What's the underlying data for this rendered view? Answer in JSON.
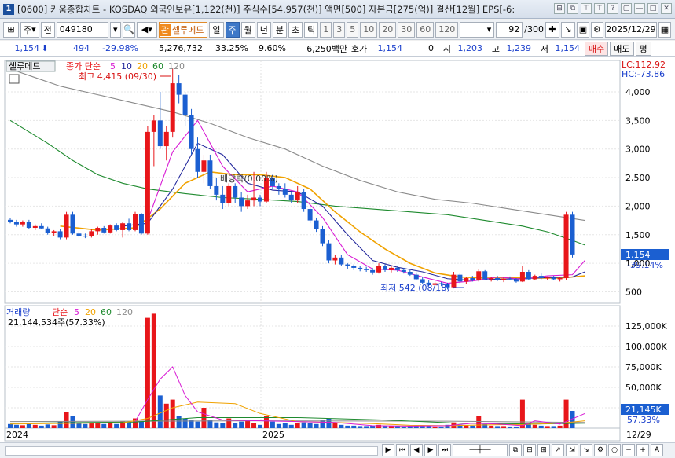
{
  "window": {
    "badge": "1",
    "title": "[0600] 키움종합차트 - KOSDAQ 외국인보유[1,122(천)] 주식수[54,957(천)] 액면[500] 자본금[275(억)] 결산[12월] EPS[-6:",
    "buttons": [
      "⊟",
      "⧉",
      "⊤",
      "T",
      "?",
      "▢",
      "—",
      "□",
      "✕"
    ]
  },
  "toolbar": {
    "period_type": "주",
    "prev": "전",
    "code": "049180",
    "stock_name": "셀루메드",
    "stock_badge": "관",
    "periods": [
      "일",
      "주",
      "월",
      "년",
      "분",
      "초",
      "틱"
    ],
    "selected_period": "주",
    "minutes": [
      "1",
      "3",
      "5",
      "10",
      "20",
      "30",
      "60",
      "120"
    ],
    "count": "92",
    "count_total": "/300",
    "date": "2025/12/29"
  },
  "quote": {
    "price": "1,154",
    "change": "494",
    "change_pct": "-29.98%",
    "volume": "5,276,732",
    "turnover": "33.25%",
    "extra_pct": "9.60%",
    "amount": "6,250백만",
    "hoga_label": "호가",
    "hoga": "1,154",
    "hoga_qty": "0",
    "open_label": "시",
    "open": "1,203",
    "high_label": "고",
    "high": "1,239",
    "low_label": "저",
    "low": "1,154",
    "buy_label": "매수",
    "sell_label": "매도",
    "eval_label": "평"
  },
  "colors": {
    "up": "#e8161a",
    "down": "#1b5fd1",
    "ma5": "#d81bd4",
    "ma10": "#23289c",
    "ma20": "#f0a200",
    "ma60": "#1e8a2e",
    "ma120": "#8a8a8a"
  },
  "price_panel": {
    "name_tag": "셀루메드",
    "legend_prefix": "종가 단순",
    "legend": [
      "5",
      "10",
      "20",
      "60",
      "120"
    ],
    "lc": "LC:112.92",
    "hc": "HC:-73.86",
    "high_note": "최고 4,415 (09/30)",
    "low_note": "최저 542 (08/18)",
    "event_note": "배당락(0.00%)",
    "current_price": "1,154",
    "current_pct": "-39.14%",
    "y_ticks": [
      "4,000",
      "3,500",
      "3,000",
      "2,500",
      "2,000",
      "1,500",
      "1,000",
      "500"
    ]
  },
  "volume_panel": {
    "name": "거래량",
    "legend_prefix": "단순",
    "legend": [
      "5",
      "20",
      "60",
      "120"
    ],
    "summary": "21,144,534주(57.33%)",
    "current": "21,145K",
    "current_pct": "57.33%",
    "y_ticks": [
      "125,000K",
      "100,000K",
      "75,000K",
      "50,000K",
      "25,000K"
    ]
  },
  "x_labels": [
    "2024",
    "2025"
  ],
  "x_end_label": "12/29",
  "chart_data": {
    "type": "candlestick",
    "period": "weekly",
    "price_ylim": [
      300,
      4550
    ],
    "volume_ylim": [
      0,
      150000
    ],
    "volume_unit": "K",
    "candles": [
      [
        1760,
        1800,
        1700,
        1730,
        5000
      ],
      [
        1730,
        1760,
        1640,
        1680,
        4000
      ],
      [
        1680,
        1750,
        1640,
        1720,
        3500
      ],
      [
        1720,
        1760,
        1600,
        1620,
        6000
      ],
      [
        1620,
        1680,
        1580,
        1650,
        4000
      ],
      [
        1650,
        1700,
        1600,
        1610,
        3000
      ],
      [
        1610,
        1640,
        1500,
        1530,
        4500
      ],
      [
        1530,
        1580,
        1480,
        1560,
        3500
      ],
      [
        1560,
        1600,
        1420,
        1450,
        8000
      ],
      [
        1450,
        1900,
        1420,
        1850,
        20000
      ],
      [
        1850,
        1900,
        1500,
        1520,
        15000
      ],
      [
        1520,
        1560,
        1450,
        1480,
        7000
      ],
      [
        1480,
        1520,
        1440,
        1470,
        5000
      ],
      [
        1470,
        1600,
        1450,
        1560,
        6000
      ],
      [
        1560,
        1640,
        1500,
        1620,
        7000
      ],
      [
        1620,
        1650,
        1520,
        1540,
        5000
      ],
      [
        1540,
        1680,
        1520,
        1660,
        6000
      ],
      [
        1660,
        1700,
        1560,
        1580,
        5000
      ],
      [
        1580,
        1720,
        1450,
        1700,
        8000
      ],
      [
        1700,
        1780,
        1560,
        1580,
        7000
      ],
      [
        1580,
        1900,
        1560,
        1860,
        12000
      ],
      [
        1860,
        1880,
        1500,
        1520,
        9000
      ],
      [
        1520,
        3400,
        1500,
        3300,
        135000
      ],
      [
        3300,
        3600,
        2700,
        3500,
        140000
      ],
      [
        3500,
        4000,
        3000,
        3050,
        40000
      ],
      [
        3050,
        3400,
        2800,
        3300,
        30000
      ],
      [
        3300,
        4415,
        3200,
        4150,
        35000
      ],
      [
        4150,
        4300,
        3800,
        3950,
        15000
      ],
      [
        3950,
        4000,
        3400,
        3600,
        12000
      ],
      [
        3600,
        3700,
        2900,
        3000,
        10000
      ],
      [
        3000,
        3200,
        2500,
        2600,
        8000
      ],
      [
        2600,
        2900,
        2400,
        2800,
        25000
      ],
      [
        2800,
        2900,
        2300,
        2350,
        10000
      ],
      [
        2350,
        2500,
        2100,
        2200,
        7000
      ],
      [
        2200,
        2350,
        1950,
        2050,
        6000
      ],
      [
        2050,
        2400,
        2000,
        2350,
        12000
      ],
      [
        2350,
        2400,
        2050,
        2150,
        6000
      ],
      [
        2150,
        2250,
        1900,
        2000,
        8000
      ],
      [
        2000,
        2200,
        1950,
        2100,
        9000
      ],
      [
        2100,
        2600,
        2000,
        2150,
        6000
      ],
      [
        2150,
        2200,
        2000,
        2080,
        4000
      ],
      [
        2080,
        2600,
        2050,
        2500,
        15000
      ],
      [
        2500,
        2550,
        2300,
        2350,
        8000
      ],
      [
        2350,
        2400,
        2200,
        2300,
        5000
      ],
      [
        2300,
        2400,
        2150,
        2200,
        6000
      ],
      [
        2200,
        2250,
        2050,
        2100,
        4000
      ],
      [
        2100,
        2350,
        2050,
        2250,
        6000
      ],
      [
        2250,
        2300,
        1900,
        1950,
        7000
      ],
      [
        1950,
        2000,
        1700,
        1750,
        6000
      ],
      [
        1750,
        1800,
        1550,
        1600,
        5000
      ],
      [
        1600,
        1650,
        1300,
        1350,
        10000
      ],
      [
        1350,
        1400,
        1000,
        1050,
        12000
      ],
      [
        1050,
        1150,
        980,
        1100,
        7000
      ],
      [
        1100,
        1150,
        950,
        980,
        4000
      ],
      [
        980,
        1000,
        900,
        950,
        3000
      ],
      [
        950,
        980,
        880,
        920,
        3000
      ],
      [
        920,
        960,
        860,
        900,
        2500
      ],
      [
        900,
        940,
        850,
        880,
        2500
      ],
      [
        880,
        920,
        800,
        840,
        3000
      ],
      [
        840,
        1000,
        820,
        950,
        4000
      ],
      [
        950,
        980,
        850,
        880,
        3000
      ],
      [
        880,
        960,
        840,
        920,
        2500
      ],
      [
        920,
        950,
        850,
        880,
        2500
      ],
      [
        880,
        920,
        820,
        850,
        2000
      ],
      [
        850,
        880,
        780,
        800,
        2500
      ],
      [
        800,
        840,
        700,
        720,
        3000
      ],
      [
        720,
        760,
        640,
        660,
        3500
      ],
      [
        660,
        700,
        600,
        620,
        2500
      ],
      [
        620,
        680,
        600,
        650,
        2000
      ],
      [
        650,
        670,
        600,
        630,
        2000
      ],
      [
        630,
        660,
        542,
        580,
        4000
      ],
      [
        580,
        850,
        560,
        800,
        7000
      ],
      [
        800,
        820,
        650,
        680,
        4000
      ],
      [
        680,
        760,
        640,
        740,
        3500
      ],
      [
        740,
        780,
        680,
        700,
        3000
      ],
      [
        700,
        900,
        680,
        860,
        15000
      ],
      [
        860,
        880,
        700,
        720,
        5000
      ],
      [
        720,
        760,
        680,
        740,
        3000
      ],
      [
        740,
        780,
        690,
        700,
        2500
      ],
      [
        700,
        750,
        670,
        730,
        2500
      ],
      [
        730,
        770,
        700,
        720,
        2000
      ],
      [
        720,
        740,
        660,
        680,
        2000
      ],
      [
        680,
        950,
        670,
        850,
        35000
      ],
      [
        850,
        880,
        700,
        720,
        6000
      ],
      [
        720,
        800,
        700,
        780,
        4000
      ],
      [
        780,
        820,
        720,
        740,
        3000
      ],
      [
        740,
        770,
        700,
        750,
        2500
      ],
      [
        750,
        780,
        700,
        720,
        2500
      ],
      [
        720,
        760,
        680,
        740,
        3000
      ],
      [
        740,
        1900,
        700,
        1850,
        35000
      ],
      [
        1850,
        1900,
        1100,
        1154,
        21145
      ]
    ],
    "ma": {
      "ma5": [
        [
          22,
          1750
        ],
        [
          26,
          2950
        ],
        [
          30,
          3500
        ],
        [
          34,
          2700
        ],
        [
          38,
          2250
        ],
        [
          42,
          2350
        ],
        [
          46,
          2250
        ],
        [
          50,
          1800
        ],
        [
          54,
          1150
        ],
        [
          58,
          900
        ],
        [
          62,
          880
        ],
        [
          66,
          760
        ],
        [
          70,
          650
        ],
        [
          74,
          690
        ],
        [
          78,
          760
        ],
        [
          82,
          720
        ],
        [
          86,
          780
        ],
        [
          90,
          800
        ],
        [
          92,
          1050
        ]
      ],
      "ma10": [
        [
          18,
          1650
        ],
        [
          22,
          1700
        ],
        [
          26,
          2300
        ],
        [
          30,
          3100
        ],
        [
          34,
          2900
        ],
        [
          38,
          2400
        ],
        [
          42,
          2280
        ],
        [
          46,
          2250
        ],
        [
          50,
          2000
        ],
        [
          54,
          1500
        ],
        [
          58,
          1050
        ],
        [
          62,
          930
        ],
        [
          66,
          850
        ],
        [
          70,
          730
        ],
        [
          74,
          700
        ],
        [
          78,
          720
        ],
        [
          82,
          730
        ],
        [
          86,
          750
        ],
        [
          90,
          760
        ],
        [
          92,
          850
        ]
      ],
      "ma20": [
        [
          8,
          1650
        ],
        [
          14,
          1580
        ],
        [
          20,
          1620
        ],
        [
          24,
          1950
        ],
        [
          28,
          2400
        ],
        [
          32,
          2600
        ],
        [
          36,
          2550
        ],
        [
          40,
          2550
        ],
        [
          44,
          2500
        ],
        [
          48,
          2300
        ],
        [
          52,
          1900
        ],
        [
          56,
          1550
        ],
        [
          60,
          1250
        ],
        [
          64,
          1000
        ],
        [
          68,
          830
        ],
        [
          72,
          760
        ],
        [
          76,
          740
        ],
        [
          80,
          750
        ],
        [
          84,
          740
        ],
        [
          88,
          740
        ],
        [
          92,
          780
        ]
      ],
      "ma60": [
        [
          0,
          3500
        ],
        [
          6,
          3100
        ],
        [
          10,
          2800
        ],
        [
          14,
          2550
        ],
        [
          18,
          2400
        ],
        [
          22,
          2300
        ],
        [
          28,
          2220
        ],
        [
          34,
          2150
        ],
        [
          40,
          2120
        ],
        [
          46,
          2080
        ],
        [
          52,
          2000
        ],
        [
          58,
          1950
        ],
        [
          64,
          1900
        ],
        [
          70,
          1850
        ],
        [
          76,
          1750
        ],
        [
          82,
          1650
        ],
        [
          86,
          1550
        ],
        [
          90,
          1400
        ],
        [
          92,
          1320
        ]
      ],
      "ma120": [
        [
          0,
          4400
        ],
        [
          4,
          4250
        ],
        [
          8,
          4100
        ],
        [
          14,
          3950
        ],
        [
          20,
          3800
        ],
        [
          26,
          3650
        ],
        [
          32,
          3450
        ],
        [
          38,
          3200
        ],
        [
          44,
          3000
        ],
        [
          50,
          2700
        ],
        [
          56,
          2450
        ],
        [
          62,
          2250
        ],
        [
          68,
          2120
        ],
        [
          74,
          2050
        ],
        [
          80,
          1950
        ],
        [
          86,
          1850
        ],
        [
          92,
          1750
        ]
      ]
    },
    "vol_ma": {
      "ma5": [
        [
          20,
          8000
        ],
        [
          22,
          35000
        ],
        [
          24,
          60000
        ],
        [
          26,
          75000
        ],
        [
          28,
          40000
        ],
        [
          30,
          20000
        ],
        [
          34,
          10000
        ],
        [
          40,
          9000
        ],
        [
          46,
          8000
        ],
        [
          52,
          7000
        ],
        [
          58,
          3000
        ],
        [
          64,
          2500
        ],
        [
          70,
          3000
        ],
        [
          74,
          6000
        ],
        [
          78,
          5000
        ],
        [
          82,
          3000
        ],
        [
          84,
          9000
        ],
        [
          88,
          5000
        ],
        [
          92,
          18000
        ]
      ],
      "ma20": [
        [
          0,
          5000
        ],
        [
          18,
          6500
        ],
        [
          22,
          12000
        ],
        [
          26,
          25000
        ],
        [
          30,
          32000
        ],
        [
          36,
          30000
        ],
        [
          40,
          18000
        ],
        [
          46,
          8000
        ],
        [
          52,
          7000
        ],
        [
          58,
          5500
        ],
        [
          64,
          3500
        ],
        [
          70,
          3000
        ],
        [
          76,
          4000
        ],
        [
          82,
          4500
        ],
        [
          88,
          6000
        ],
        [
          92,
          9000
        ]
      ],
      "ma60": [
        [
          0,
          6000
        ],
        [
          20,
          7500
        ],
        [
          30,
          13000
        ],
        [
          46,
          13000
        ],
        [
          60,
          10000
        ],
        [
          72,
          6000
        ],
        [
          84,
          5000
        ],
        [
          92,
          6000
        ]
      ],
      "ma120": [
        [
          0,
          8000
        ],
        [
          40,
          9000
        ],
        [
          70,
          8500
        ],
        [
          92,
          7000
        ]
      ]
    }
  }
}
